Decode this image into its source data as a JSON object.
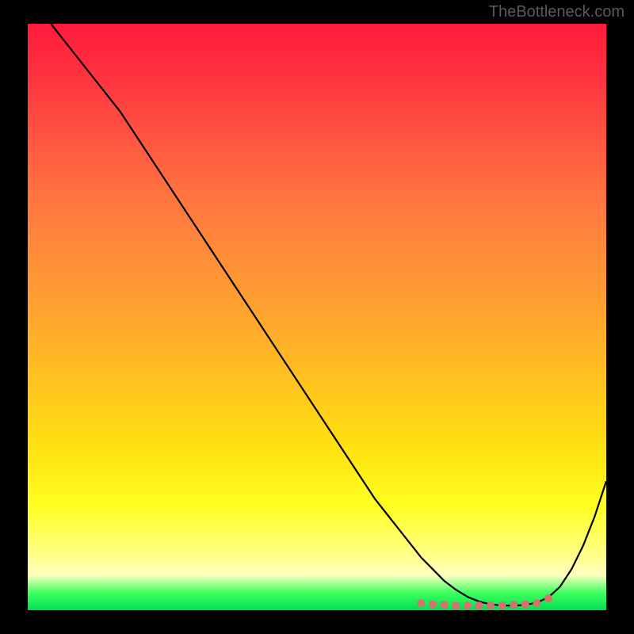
{
  "watermark": "TheBottleneck.com",
  "chart_data": {
    "type": "line",
    "title": "",
    "xlabel": "",
    "ylabel": "",
    "xlim": [
      0,
      100
    ],
    "ylim": [
      0,
      100
    ],
    "series": [
      {
        "name": "curve",
        "x": [
          4,
          8,
          12,
          16,
          20,
          24,
          28,
          32,
          36,
          40,
          44,
          48,
          52,
          56,
          60,
          64,
          68,
          70,
          72,
          74,
          76,
          78,
          80,
          82,
          84,
          86,
          88,
          90,
          92,
          94,
          96,
          98,
          100
        ],
        "y": [
          100,
          95,
          90,
          85,
          79,
          73,
          67,
          61,
          55,
          49,
          43,
          37,
          31,
          25,
          19,
          14,
          9,
          7,
          5,
          3.5,
          2.3,
          1.5,
          1.0,
          0.8,
          0.8,
          0.9,
          1.3,
          2.2,
          4.0,
          7.0,
          11,
          16,
          22
        ],
        "color": "#000000"
      },
      {
        "name": "bottom-dots",
        "x": [
          68,
          70,
          72,
          74,
          76,
          78,
          80,
          82,
          84,
          86,
          88,
          90
        ],
        "y": [
          1.2,
          1.0,
          0.9,
          0.8,
          0.8,
          0.8,
          0.8,
          0.8,
          0.9,
          1.0,
          1.2,
          2.0
        ],
        "color": "#d87070"
      }
    ],
    "gradient_stops": [
      {
        "pos": 0,
        "color": "#ff1a3a"
      },
      {
        "pos": 50,
        "color": "#ffb020"
      },
      {
        "pos": 85,
        "color": "#ffff40"
      },
      {
        "pos": 100,
        "color": "#00e050"
      }
    ]
  }
}
